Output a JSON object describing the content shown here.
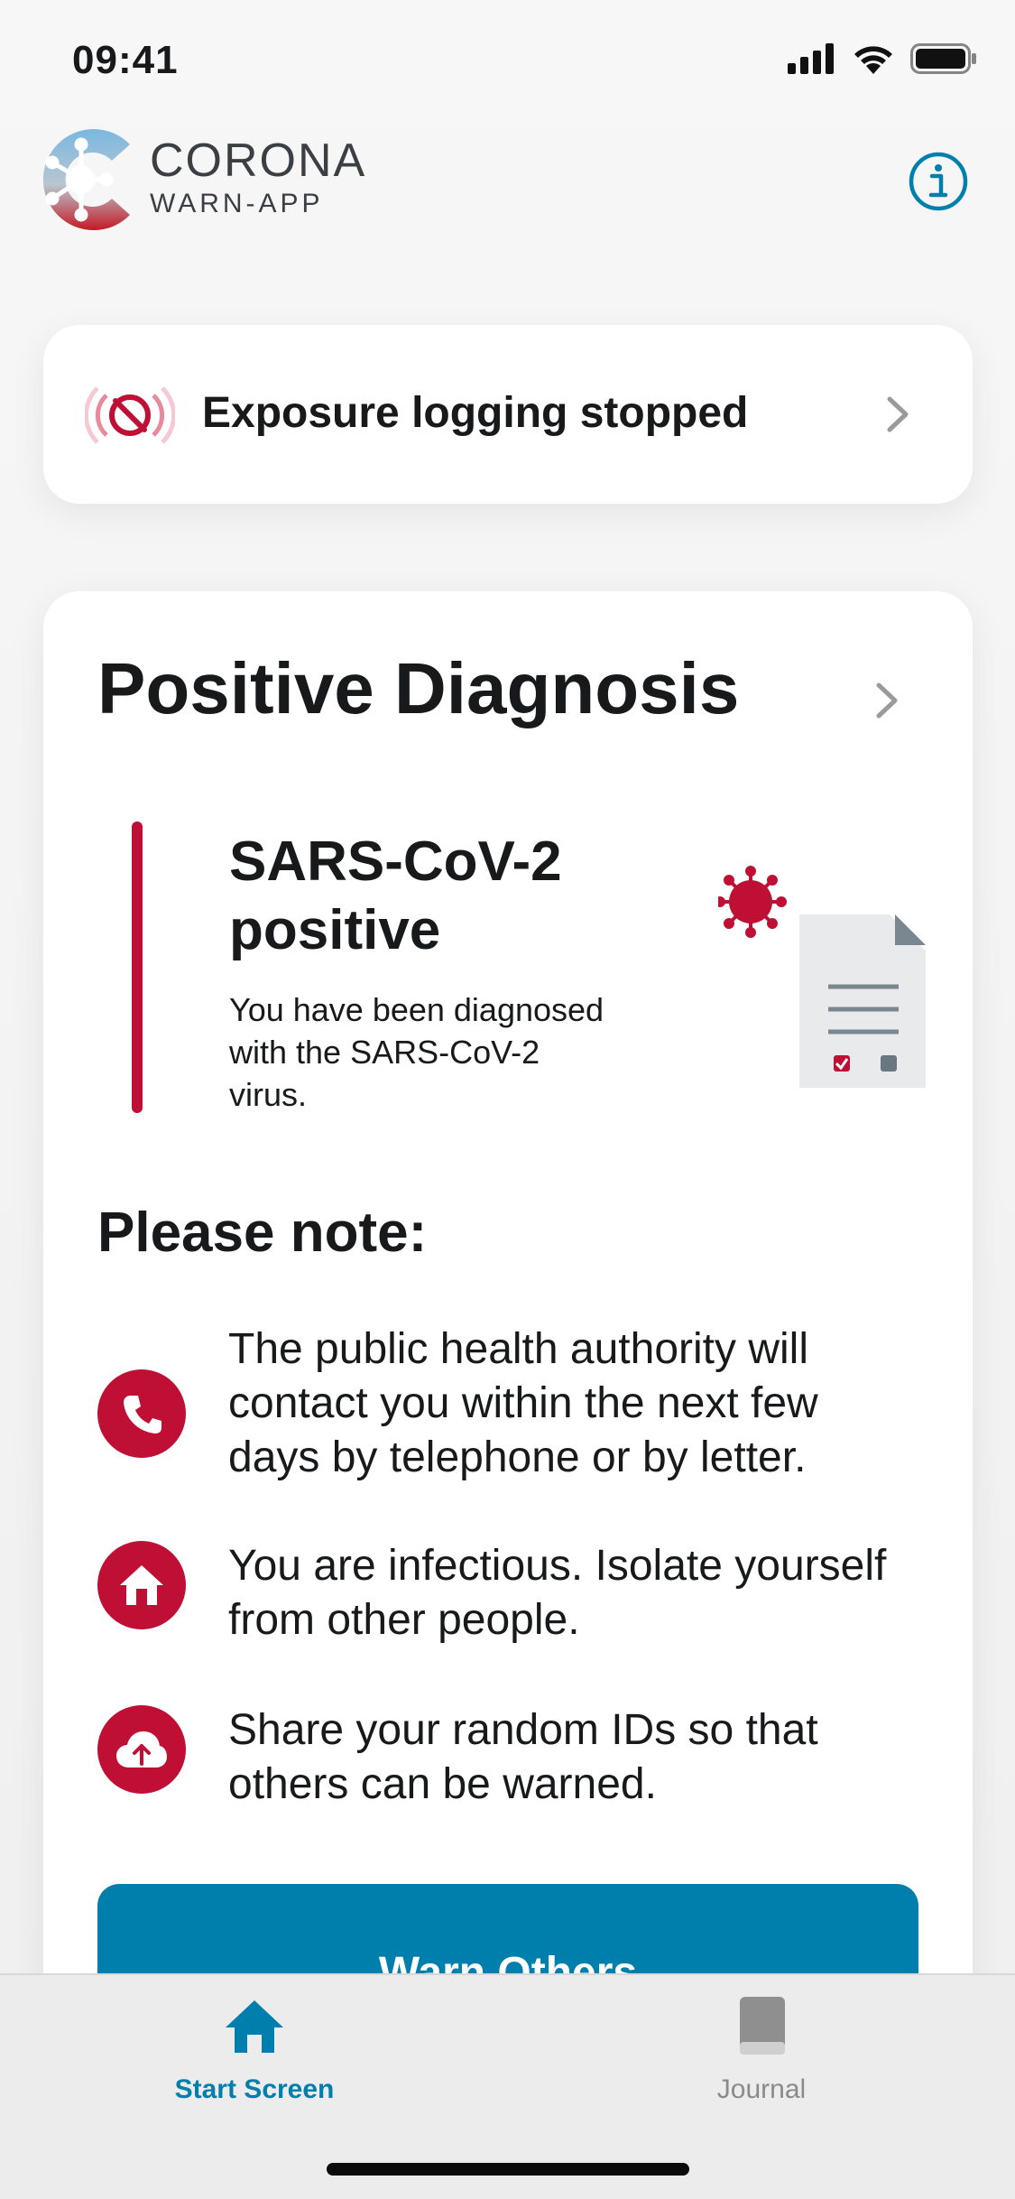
{
  "status_bar": {
    "time": "09:41",
    "icons": [
      "signal-icon",
      "wifi-icon",
      "battery-icon"
    ]
  },
  "header": {
    "logo_title": "CORONA",
    "logo_subtitle": "WARN-APP",
    "info_icon": "info-icon"
  },
  "exposure_card": {
    "label": "Exposure logging stopped",
    "icon": "exposure-stopped-icon"
  },
  "diagnosis_card": {
    "title": "Positive Diagnosis",
    "result_title": "SARS-CoV-2 positive",
    "result_text": "You have been diagnosed with the SARS-CoV-2 virus.",
    "note_title": "Please note:",
    "notes": [
      {
        "icon": "phone-icon",
        "text": "The public health authority will contact you within the next few days by telephone or by letter."
      },
      {
        "icon": "home-icon",
        "text": "You are infectious. Isolate yourself from other people."
      },
      {
        "icon": "cloud-upload-icon",
        "text": "Share your random IDs so that others can be warned."
      }
    ],
    "button_label": "Warn Others"
  },
  "tab_bar": {
    "tabs": [
      {
        "label": "Start Screen",
        "icon": "home-icon",
        "active": true
      },
      {
        "label": "Journal",
        "icon": "book-icon",
        "active": false
      }
    ]
  },
  "colors": {
    "accent_blue": "#007fad",
    "alert_red": "#c00f35",
    "background": "#f3f3f3",
    "text": "#17191a"
  }
}
